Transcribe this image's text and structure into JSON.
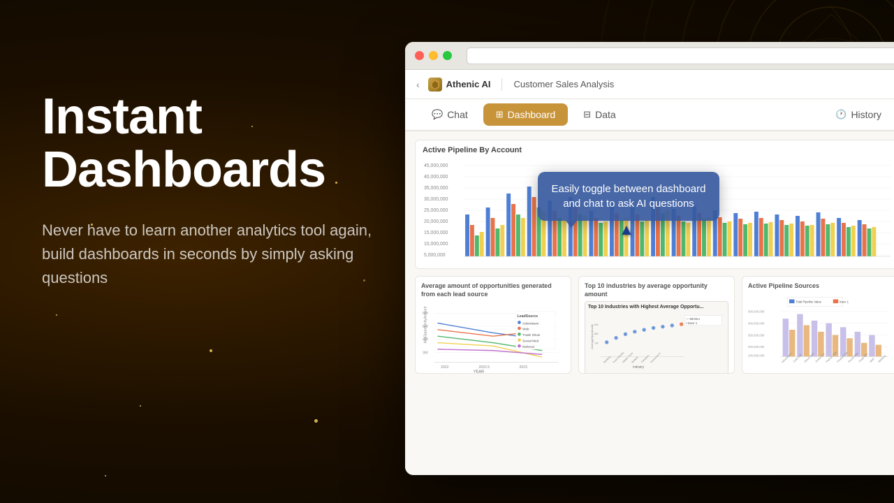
{
  "background": {
    "baseColor": "#1a0e00",
    "accentColor": "#c8943a"
  },
  "leftPanel": {
    "headline": "Instant\nDashboards",
    "subtext": "Never have to learn another analytics tool again, build dashboards in seconds by simply asking questions"
  },
  "browser": {
    "titlebar": {
      "btn_red": "red",
      "btn_yellow": "yellow",
      "btn_green": "green"
    },
    "appHeader": {
      "backArrow": "‹",
      "brandName": "Athenic AI",
      "pageTitle": "Customer Sales Analysis"
    },
    "tabs": [
      {
        "id": "chat",
        "label": "Chat",
        "icon": "💬",
        "active": false
      },
      {
        "id": "dashboard",
        "label": "Dashboard",
        "icon": "⊞",
        "active": true
      },
      {
        "id": "data",
        "label": "Data",
        "icon": "⊟",
        "active": false
      },
      {
        "id": "history",
        "label": "History",
        "icon": "🕐",
        "active": false
      }
    ],
    "mainChart": {
      "title": "Active Pipeline By Account"
    },
    "bottomCharts": [
      {
        "title": "Average amount of opportunities generated from each lead source",
        "xLabel": "YEAR"
      },
      {
        "title": "Top 10 industries by average opportunity amount",
        "subtitle": "Top 10 Industries with Highest Average Opportu..."
      },
      {
        "title": "Active Pipeline Sources",
        "legendItems": [
          "Total Pipeline Value",
          "trace 1"
        ]
      }
    ],
    "tooltip": {
      "text": "Easily toggle between dashboard and chat to ask AI questions"
    }
  }
}
